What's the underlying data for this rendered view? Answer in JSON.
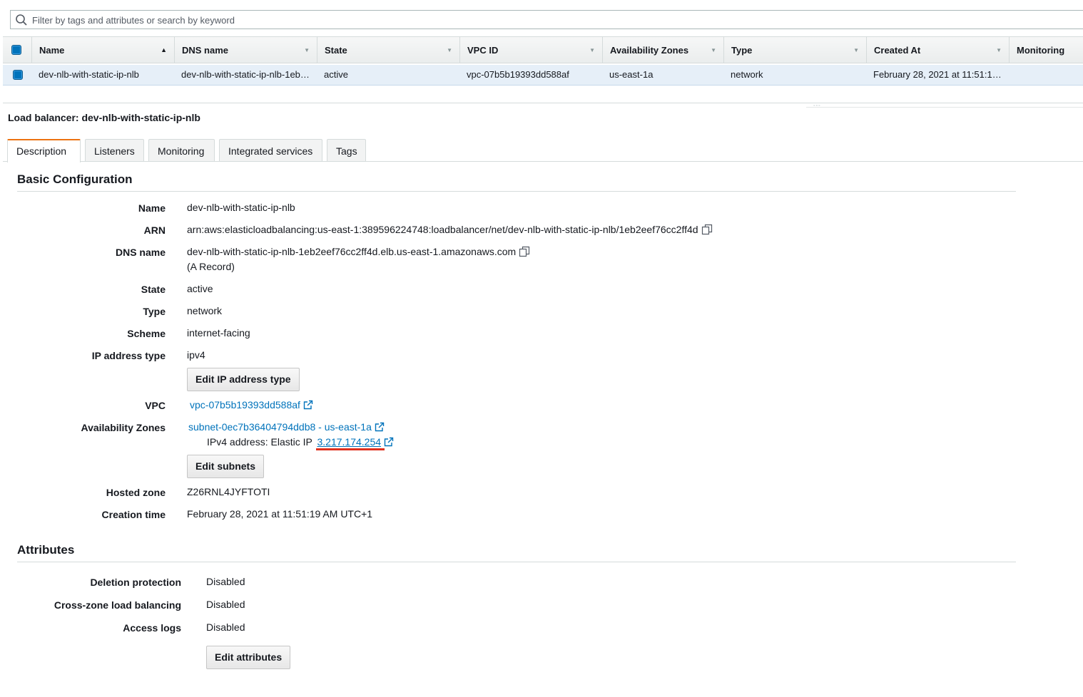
{
  "search": {
    "placeholder": "Filter by tags and attributes or search by keyword",
    "icon": "search-icon"
  },
  "table": {
    "columns": [
      "Name",
      "DNS name",
      "State",
      "VPC ID",
      "Availability Zones",
      "Type",
      "Created At",
      "Monitoring"
    ],
    "sort_column": "Name",
    "sort_direction": "ascending",
    "rows": [
      {
        "selected": true,
        "name": "dev-nlb-with-static-ip-nlb",
        "dns_name": "dev-nlb-with-static-ip-nlb-1eb…",
        "state": "active",
        "vpc_id": "vpc-07b5b19393dd588af",
        "availability_zones": "us-east-1a",
        "type": "network",
        "created_at": "February 28, 2021 at 11:51:1…",
        "monitoring": ""
      }
    ]
  },
  "detail": {
    "title": "Load balancer: dev-nlb-with-static-ip-nlb",
    "tabs": [
      "Description",
      "Listeners",
      "Monitoring",
      "Integrated services",
      "Tags"
    ],
    "active_tab": "Description",
    "basic": {
      "heading": "Basic Configuration",
      "name_label": "Name",
      "name": "dev-nlb-with-static-ip-nlb",
      "arn_label": "ARN",
      "arn": "arn:aws:elasticloadbalancing:us-east-1:389596224748:loadbalancer/net/dev-nlb-with-static-ip-nlb/1eb2eef76cc2ff4d",
      "dns_label": "DNS name",
      "dns": "dev-nlb-with-static-ip-nlb-1eb2eef76cc2ff4d.elb.us-east-1.amazonaws.com",
      "dns_record": "(A Record)",
      "state_label": "State",
      "state": "active",
      "type_label": "Type",
      "type": "network",
      "scheme_label": "Scheme",
      "scheme": "internet-facing",
      "ip_type_label": "IP address type",
      "ip_type": "ipv4",
      "edit_ip_button": "Edit IP address type",
      "vpc_label": "VPC",
      "vpc": "vpc-07b5b19393dd588af",
      "az_label": "Availability Zones",
      "subnet": "subnet-0ec7b36404794ddb8 - us-east-1a",
      "ipv4_prefix": "IPv4 address: Elastic IP",
      "elastic_ip": "3.217.174.254",
      "edit_subnets_button": "Edit subnets",
      "hosted_zone_label": "Hosted zone",
      "hosted_zone": "Z26RNL4JYFTOTI",
      "creation_label": "Creation time",
      "creation": "February 28, 2021 at 11:51:19 AM UTC+1"
    },
    "attributes": {
      "heading": "Attributes",
      "deletion_label": "Deletion protection",
      "deletion": "Disabled",
      "crosszone_label": "Cross-zone load balancing",
      "crosszone": "Disabled",
      "accesslogs_label": "Access logs",
      "accesslogs": "Disabled",
      "edit_button": "Edit attributes"
    }
  },
  "colors": {
    "link": "#0073bb",
    "active_tab_accent": "#ec7211",
    "selected_row": "#e6eff8",
    "highlight": "#e0301e"
  }
}
